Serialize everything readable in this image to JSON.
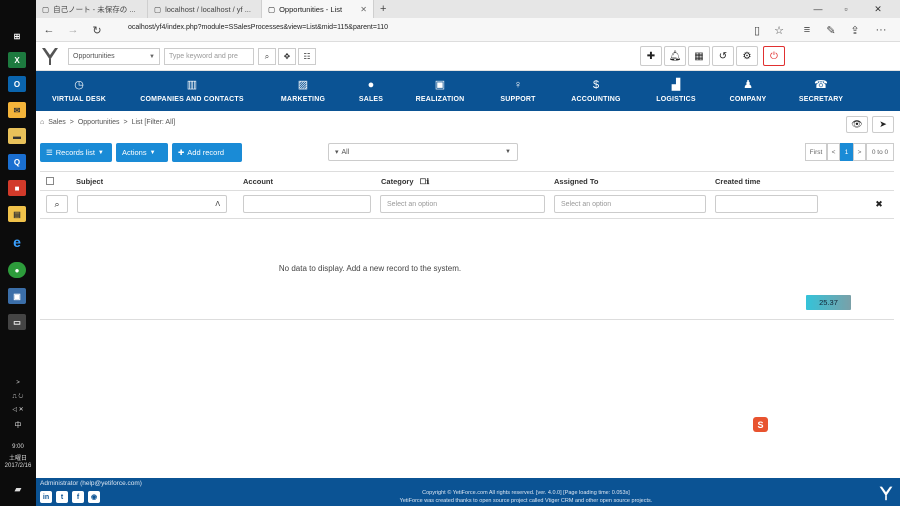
{
  "os": {
    "taskbar": {
      "clock_time": "9:00",
      "clock_day": "土曜日",
      "clock_date": "2017/2/16",
      "tray_ime": "中",
      "tray_arrow": ">"
    }
  },
  "browser": {
    "tabs": [
      {
        "label": "自己ノート - 未保存の ...",
        "active": false
      },
      {
        "label": "localhost / localhost / yf ...",
        "active": false
      },
      {
        "label": "Opportunities - List",
        "active": true
      }
    ],
    "url": "ocalhost/yf4/index.php?module=SSalesProcesses&view=List&mid=115&parent=110"
  },
  "app": {
    "module_select": "Opportunities",
    "search_placeholder": "Type keyword and pre",
    "nav": [
      {
        "label": "VIRTUAL DESK",
        "icon": "clock-icon"
      },
      {
        "label": "COMPANIES AND CONTACTS",
        "icon": "building-icon"
      },
      {
        "label": "MARKETING",
        "icon": "chart-icon"
      },
      {
        "label": "SALES",
        "icon": "piggy-bank-icon"
      },
      {
        "label": "REALIZATION",
        "icon": "briefcase-icon"
      },
      {
        "label": "SUPPORT",
        "icon": "lightbulb-icon"
      },
      {
        "label": "ACCOUNTING",
        "icon": "dollar-icon"
      },
      {
        "label": "LOGISTICS",
        "icon": "truck-icon"
      },
      {
        "label": "COMPANY",
        "icon": "people-icon"
      },
      {
        "label": "SECRETARY",
        "icon": "phone-icon"
      }
    ],
    "breadcrumb": {
      "module": "Sales",
      "page": "Opportunities",
      "view": "List [Filter: All]"
    },
    "toolbar": {
      "records_list": "Records list",
      "actions": "Actions",
      "add_record": "Add record",
      "filter": "All"
    },
    "pagination": {
      "first": "First",
      "prev": "<",
      "current": "1",
      "next": ">",
      "range": "0 to 0"
    },
    "table": {
      "columns": [
        "Subject",
        "Account",
        "Category",
        "Assigned To",
        "Created time"
      ],
      "category_placeholder": "Select an option",
      "assigned_placeholder": "Select an option",
      "subject_sort_glyph": "Λ",
      "empty_message": "No data to display. Add a new record to the system."
    },
    "timer_value": "25.37",
    "footer": {
      "user": "Administrator (help@yetiforce.com)",
      "copyright_line1": "Copyright © YetiForce.com All rights reserved. [ver. 4.0.0] [Page loading time: 0.053s]",
      "copyright_line2": "YetiForce was created thanks to open source project called Vtiger CRM and other open source projects."
    }
  },
  "colors": {
    "nav_bg": "#0b5394",
    "primary_button": "#1a8bd6",
    "power_button": "#e03030"
  }
}
